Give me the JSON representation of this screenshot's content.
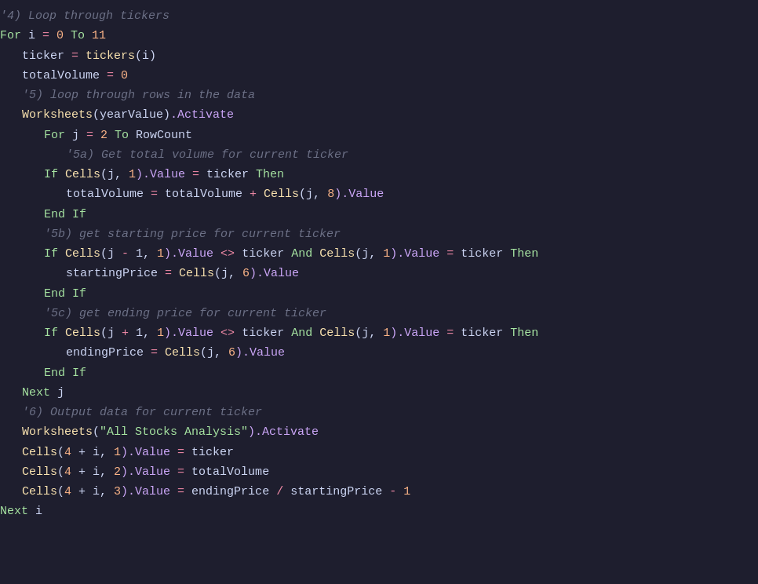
{
  "code": {
    "lines": [
      {
        "indent": 0,
        "tokens": [
          {
            "t": "'4) Loop through tickers",
            "c": "comment"
          }
        ]
      },
      {
        "indent": 0,
        "tokens": [
          {
            "t": "For",
            "c": "green"
          },
          {
            "t": " i ",
            "c": "white"
          },
          {
            "t": "=",
            "c": "pink"
          },
          {
            "t": " ",
            "c": "white"
          },
          {
            "t": "0",
            "c": "number"
          },
          {
            "t": " To ",
            "c": "green"
          },
          {
            "t": "11",
            "c": "number"
          }
        ]
      },
      {
        "indent": 1,
        "tokens": [
          {
            "t": "ticker",
            "c": "white"
          },
          {
            "t": " = ",
            "c": "pink"
          },
          {
            "t": "tickers",
            "c": "yellow"
          },
          {
            "t": "(i)",
            "c": "white"
          }
        ]
      },
      {
        "indent": 1,
        "tokens": [
          {
            "t": "totalVolume",
            "c": "white"
          },
          {
            "t": " = ",
            "c": "pink"
          },
          {
            "t": "0",
            "c": "number"
          }
        ]
      },
      {
        "indent": 1,
        "tokens": [
          {
            "t": "'5) loop through rows in the data",
            "c": "comment"
          }
        ]
      },
      {
        "indent": 1,
        "tokens": [
          {
            "t": "Worksheets",
            "c": "yellow"
          },
          {
            "t": "(yearValue)",
            "c": "white"
          },
          {
            "t": ".Activate",
            "c": "purple"
          }
        ]
      },
      {
        "indent": 2,
        "tokens": [
          {
            "t": "For",
            "c": "green"
          },
          {
            "t": " j ",
            "c": "white"
          },
          {
            "t": "=",
            "c": "pink"
          },
          {
            "t": " ",
            "c": "white"
          },
          {
            "t": "2",
            "c": "number"
          },
          {
            "t": " To ",
            "c": "green"
          },
          {
            "t": "RowCount",
            "c": "white"
          }
        ]
      },
      {
        "indent": 3,
        "tokens": [
          {
            "t": "'5a) Get total volume for current ticker",
            "c": "comment"
          }
        ]
      },
      {
        "indent": 2,
        "tokens": [
          {
            "t": "If",
            "c": "green"
          },
          {
            "t": " Cells",
            "c": "yellow"
          },
          {
            "t": "(j, ",
            "c": "white"
          },
          {
            "t": "1",
            "c": "number"
          },
          {
            "t": ").Value ",
            "c": "purple"
          },
          {
            "t": "=",
            "c": "pink"
          },
          {
            "t": " ticker ",
            "c": "white"
          },
          {
            "t": "Then",
            "c": "green"
          }
        ]
      },
      {
        "indent": 3,
        "tokens": [
          {
            "t": "totalVolume",
            "c": "white"
          },
          {
            "t": " = ",
            "c": "pink"
          },
          {
            "t": "totalVolume",
            "c": "white"
          },
          {
            "t": " + ",
            "c": "pink"
          },
          {
            "t": "Cells",
            "c": "yellow"
          },
          {
            "t": "(j, ",
            "c": "white"
          },
          {
            "t": "8",
            "c": "number"
          },
          {
            "t": ").Value",
            "c": "purple"
          }
        ]
      },
      {
        "indent": 2,
        "tokens": [
          {
            "t": "End If",
            "c": "green"
          }
        ]
      },
      {
        "indent": 2,
        "tokens": [
          {
            "t": "'5b) get starting price for current ticker",
            "c": "comment"
          }
        ]
      },
      {
        "indent": 2,
        "tokens": [
          {
            "t": "If",
            "c": "green"
          },
          {
            "t": " Cells",
            "c": "yellow"
          },
          {
            "t": "(j ",
            "c": "white"
          },
          {
            "t": "-",
            "c": "pink"
          },
          {
            "t": " 1, ",
            "c": "white"
          },
          {
            "t": "1",
            "c": "number"
          },
          {
            "t": ").Value ",
            "c": "purple"
          },
          {
            "t": "<>",
            "c": "pink"
          },
          {
            "t": " ticker ",
            "c": "white"
          },
          {
            "t": "And",
            "c": "green"
          },
          {
            "t": " Cells",
            "c": "yellow"
          },
          {
            "t": "(j, ",
            "c": "white"
          },
          {
            "t": "1",
            "c": "number"
          },
          {
            "t": ").Value ",
            "c": "purple"
          },
          {
            "t": "=",
            "c": "pink"
          },
          {
            "t": " ticker ",
            "c": "white"
          },
          {
            "t": "Then",
            "c": "green"
          }
        ]
      },
      {
        "indent": 3,
        "tokens": [
          {
            "t": "startingPrice",
            "c": "white"
          },
          {
            "t": " = ",
            "c": "pink"
          },
          {
            "t": "Cells",
            "c": "yellow"
          },
          {
            "t": "(j, ",
            "c": "white"
          },
          {
            "t": "6",
            "c": "number"
          },
          {
            "t": ").Value",
            "c": "purple"
          }
        ]
      },
      {
        "indent": 2,
        "tokens": [
          {
            "t": "End If",
            "c": "green"
          }
        ]
      },
      {
        "indent": 2,
        "tokens": [
          {
            "t": "'5c) get ending price for current ticker",
            "c": "comment"
          }
        ]
      },
      {
        "indent": 2,
        "tokens": [
          {
            "t": "If",
            "c": "green"
          },
          {
            "t": " Cells",
            "c": "yellow"
          },
          {
            "t": "(j ",
            "c": "white"
          },
          {
            "t": "+",
            "c": "pink"
          },
          {
            "t": " 1, ",
            "c": "white"
          },
          {
            "t": "1",
            "c": "number"
          },
          {
            "t": ").Value ",
            "c": "purple"
          },
          {
            "t": "<>",
            "c": "pink"
          },
          {
            "t": " ticker ",
            "c": "white"
          },
          {
            "t": "And",
            "c": "green"
          },
          {
            "t": " Cells",
            "c": "yellow"
          },
          {
            "t": "(j, ",
            "c": "white"
          },
          {
            "t": "1",
            "c": "number"
          },
          {
            "t": ").Value ",
            "c": "purple"
          },
          {
            "t": "=",
            "c": "pink"
          },
          {
            "t": " ticker ",
            "c": "white"
          },
          {
            "t": "Then",
            "c": "green"
          }
        ]
      },
      {
        "indent": 3,
        "tokens": [
          {
            "t": "endingPrice",
            "c": "white"
          },
          {
            "t": " = ",
            "c": "pink"
          },
          {
            "t": "Cells",
            "c": "yellow"
          },
          {
            "t": "(j, ",
            "c": "white"
          },
          {
            "t": "6",
            "c": "number"
          },
          {
            "t": ").Value",
            "c": "purple"
          }
        ]
      },
      {
        "indent": 2,
        "tokens": [
          {
            "t": "End If",
            "c": "green"
          }
        ]
      },
      {
        "indent": 1,
        "tokens": [
          {
            "t": "Next",
            "c": "green"
          },
          {
            "t": " j",
            "c": "white"
          }
        ]
      },
      {
        "indent": 1,
        "tokens": [
          {
            "t": "'6) Output data for current ticker",
            "c": "comment"
          }
        ]
      },
      {
        "indent": 1,
        "tokens": [
          {
            "t": "Worksheets",
            "c": "yellow"
          },
          {
            "t": "(",
            "c": "white"
          },
          {
            "t": "\"All Stocks Analysis\"",
            "c": "string"
          },
          {
            "t": ").Activate",
            "c": "purple"
          }
        ]
      },
      {
        "indent": 1,
        "tokens": [
          {
            "t": "Cells",
            "c": "yellow"
          },
          {
            "t": "(",
            "c": "white"
          },
          {
            "t": "4",
            "c": "number"
          },
          {
            "t": " + i, ",
            "c": "white"
          },
          {
            "t": "1",
            "c": "number"
          },
          {
            "t": ").Value ",
            "c": "purple"
          },
          {
            "t": "=",
            "c": "pink"
          },
          {
            "t": " ticker",
            "c": "white"
          }
        ]
      },
      {
        "indent": 1,
        "tokens": [
          {
            "t": "Cells",
            "c": "yellow"
          },
          {
            "t": "(",
            "c": "white"
          },
          {
            "t": "4",
            "c": "number"
          },
          {
            "t": " + i, ",
            "c": "white"
          },
          {
            "t": "2",
            "c": "number"
          },
          {
            "t": ").Value ",
            "c": "purple"
          },
          {
            "t": "=",
            "c": "pink"
          },
          {
            "t": " totalVolume",
            "c": "white"
          }
        ]
      },
      {
        "indent": 1,
        "tokens": [
          {
            "t": "Cells",
            "c": "yellow"
          },
          {
            "t": "(",
            "c": "white"
          },
          {
            "t": "4",
            "c": "number"
          },
          {
            "t": " + i, ",
            "c": "white"
          },
          {
            "t": "3",
            "c": "number"
          },
          {
            "t": ").Value ",
            "c": "purple"
          },
          {
            "t": "=",
            "c": "pink"
          },
          {
            "t": " endingPrice ",
            "c": "white"
          },
          {
            "t": "/",
            "c": "pink"
          },
          {
            "t": " startingPrice ",
            "c": "white"
          },
          {
            "t": "-",
            "c": "pink"
          },
          {
            "t": " ",
            "c": "white"
          },
          {
            "t": "1",
            "c": "number"
          }
        ]
      },
      {
        "indent": 0,
        "tokens": [
          {
            "t": "Next",
            "c": "green"
          },
          {
            "t": " i",
            "c": "white"
          }
        ]
      }
    ]
  }
}
